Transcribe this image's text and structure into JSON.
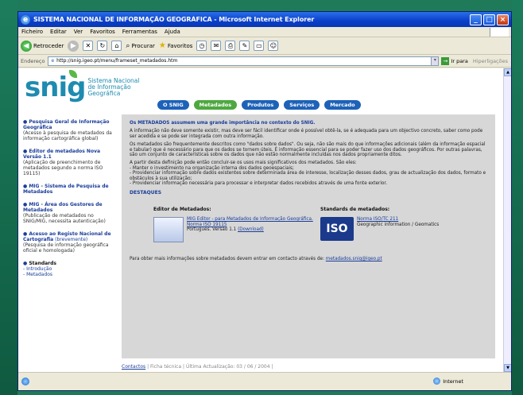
{
  "window": {
    "title": "SISTEMA NACIONAL DE INFORMAÇÃO GEOGRÁFICA - Microsoft Internet Explorer"
  },
  "menubar": [
    "Ficheiro",
    "Editar",
    "Ver",
    "Favoritos",
    "Ferramentas",
    "Ajuda"
  ],
  "toolbar": {
    "back_label": "Retroceder",
    "search_label": "Procurar",
    "favorites_label": "Favoritos"
  },
  "addressbar": {
    "label": "Endereço",
    "url": "http://snig.igeo.pt/menu/frameset_metadados.htm",
    "go_label": "Ir para",
    "links_label": "Hiperligações"
  },
  "header": {
    "logo": "snig",
    "logo_sub": [
      "Sistema Nacional",
      "de Informação",
      "Geográfica"
    ]
  },
  "nav": [
    "O SNIG",
    "Metadados",
    "Produtos",
    "Serviços",
    "Mercado"
  ],
  "sidebar": [
    {
      "head": "Pesquisa Geral de Informação Geográfica",
      "text": "(Acesso à pesquisa de metadados da informação cartográfica global)"
    },
    {
      "head": "Editor de metadados Nova Versão 1.1",
      "text": "(Aplicação de preenchimento de metadados segundo a norma ISO 19115)"
    },
    {
      "head": "MIG - Sistema de Pesquisa de Metadados",
      "text": ""
    },
    {
      "head": "MIG - Área dos Gestores de Metadados",
      "text": "(Publicação de metadados no SNIG/MIG, necessita autenticação)"
    },
    {
      "head": "Acesso ao Registo Nacional de Cartografia",
      "extra": "(brevemente)",
      "text": "(Pesquisa de informação geográfica oficial e homologada)"
    },
    {
      "head": "Standards",
      "links": [
        "- Introdução",
        "- Metadados"
      ]
    }
  ],
  "main": {
    "lead": "Os METADADOS assumem uma grande importância no contexto do SNIG.",
    "p1": "A informação não deve somente existir, mas deve ser fácil identificar onde é possível obtê-la, se é adequada para um objectivo concreto, saber como pode ser acedida e se pode ser integrada com outra informação.",
    "p2": "Os metadados são frequentemente descritos como \"dados sobre dados\". Ou seja, não são mais do que informações adicionais (além da informação espacial e tabular) que é necessário para que os dados se tornem úteis. É informação essencial para se poder fazer uso dos dados geográficos. Por outras palavras, são um conjunto de características sobre os dados que não estão normalmente incluídas nos dados propriamente ditos.",
    "p3": "A partir desta definição pode então concluir-se os usos mais significativos dos metadados. São eles:",
    "bullets": [
      "- Manter o investimento na organização interna dos dados geoespaciais;",
      "- Providenciar informação sobre dados existentes sobre determinada área de interesse, localização desses dados, grau de actualização dos dados, formato e obstáculos à sua utilização;",
      "- Providenciar informação necessária para processar e interpretar dados recebidos através de uma fonte exterior."
    ],
    "destaques": "DESTAQUES",
    "editor_title": "Editor de Metadados:",
    "editor_link": "MIG Editor - para Metadados de Informação Geográfica.",
    "editor_norm": "Norma ISO 19115",
    "editor_version": "Português. Versão 1.1",
    "editor_download": "(Download)",
    "standards_title": "Standards de metadados:",
    "iso_label": "ISO",
    "iso_link": "Norma ISO/TC 211",
    "iso_desc": "Geographic information / Geomatics",
    "contact_text": "Para obter mais informações sobre metadados devem entrar em contacto através de:",
    "contact_email": "metadados.snig@igeo.pt"
  },
  "footer": {
    "contact": "Contactos",
    "rest": "| Ficha técnica | Última Actualização: 03 / 06 / 2004 |"
  },
  "status": {
    "zone": "Internet"
  }
}
